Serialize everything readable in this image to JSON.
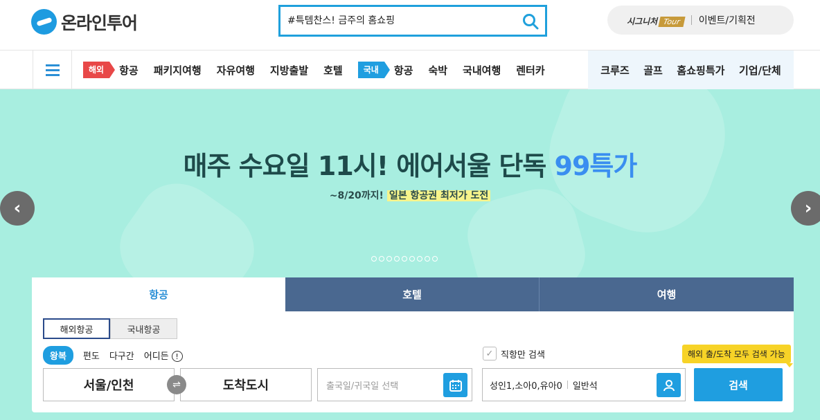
{
  "header": {
    "logo_text": "온라인투어",
    "search_placeholder": "#특템찬스! 금주의 홈쇼핑",
    "signature_label": "시그니처",
    "tour_badge": "Tour",
    "events_label": "이벤트/기획전"
  },
  "gnb": {
    "overseas_tag": "해외",
    "overseas_items": [
      "항공",
      "패키지여행",
      "자유여행",
      "지방출발",
      "호텔"
    ],
    "domestic_tag": "국내",
    "domestic_items": [
      "항공",
      "숙박",
      "국내여행",
      "렌터카"
    ],
    "right_items": [
      "크루즈",
      "골프",
      "홈쇼핑특가",
      "기업/단체"
    ]
  },
  "banner": {
    "headline_main": "매주 수요일 11시! 에어서울 단독 ",
    "headline_highlight": "99특가",
    "subline_prefix": "~8/20까지! ",
    "subline_marked": "일본 항공권 최저가 도전",
    "dot_count": 9,
    "prev_label": "‹",
    "next_label": "›"
  },
  "search_panel": {
    "tabs": [
      "항공",
      "호텔",
      "여행"
    ],
    "subtabs": [
      "해외항공",
      "국내항공"
    ],
    "trip_types": [
      "왕복",
      "편도",
      "다구간",
      "어디든"
    ],
    "info_icon": "!",
    "direct_only": "직항만 검색",
    "tooltip": "해외 출/도착 모두 검색 가능",
    "origin": "서울/인천",
    "swap_icon": "⇌",
    "destination": "도착도시",
    "date_placeholder": "출국일/귀국일 선택",
    "passengers": "성인1,소아0,유아0",
    "cabin": "일반석",
    "search_button": "검색"
  },
  "colors": {
    "brand_blue": "#1f9ee0",
    "banner_bg": "#a8eee0",
    "tab_dark": "#4a6890",
    "tag_red": "#e84848",
    "tooltip_yellow": "#f7d327"
  }
}
